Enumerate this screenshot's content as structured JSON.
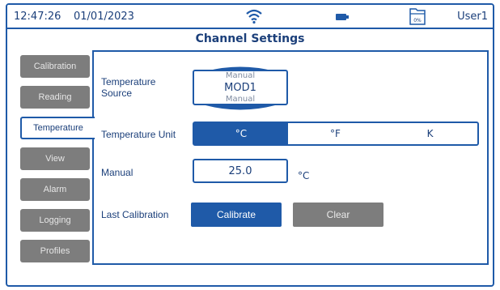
{
  "status": {
    "time": "12:47:26",
    "date": "01/01/2023",
    "user": "User1",
    "storage_percent": "0%",
    "icons": [
      "wifi-icon",
      "battery-icon",
      "storage-icon"
    ]
  },
  "title": "Channel Settings",
  "sidebar": {
    "items": [
      {
        "label": "Calibration"
      },
      {
        "label": "Reading"
      },
      {
        "label": "Temperature"
      },
      {
        "label": "View"
      },
      {
        "label": "Alarm"
      },
      {
        "label": "Logging"
      },
      {
        "label": "Profiles"
      }
    ],
    "active": "Temperature"
  },
  "form": {
    "source_label": "Temperature Source",
    "source_prev": "Manual",
    "source_value": "MOD1",
    "source_next": "Manual",
    "unit_label": "Temperature Unit",
    "units": [
      "°C",
      "°F",
      "K"
    ],
    "selected_unit": "°C",
    "manual_label": "Manual",
    "manual_value": "25.0",
    "manual_unit": "°C",
    "calibration_label": "Last Calibration",
    "calibrate_button": "Calibrate",
    "clear_button": "Clear"
  },
  "colors": {
    "accent": "#1f5aa8",
    "text": "#1b3f7a",
    "inactive_tab": "#7d7d7d"
  }
}
